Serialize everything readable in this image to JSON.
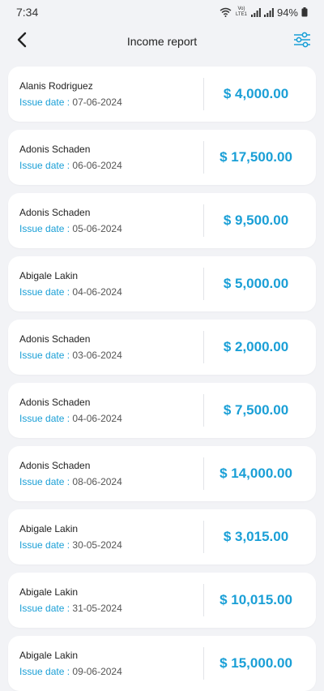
{
  "status_bar": {
    "time": "7:34",
    "network_label": "Vo) LTE1",
    "battery": "94%"
  },
  "header": {
    "title": "Income report"
  },
  "colors": {
    "accent": "#1a9fd6",
    "background": "#f2f3f6",
    "card": "#ffffff"
  },
  "icons": {
    "back": "back-arrow-icon",
    "filter": "sliders-icon"
  },
  "issue_label": "Issue date :",
  "invoices": [
    {
      "name": "Alanis Rodriguez",
      "date": "07-06-2024",
      "amount": "$ 4,000.00"
    },
    {
      "name": "Adonis Schaden",
      "date": "06-06-2024",
      "amount": "$ 17,500.00"
    },
    {
      "name": "Adonis Schaden",
      "date": "05-06-2024",
      "amount": "$ 9,500.00"
    },
    {
      "name": "Abigale Lakin",
      "date": "04-06-2024",
      "amount": "$ 5,000.00"
    },
    {
      "name": "Adonis Schaden",
      "date": "03-06-2024",
      "amount": "$ 2,000.00"
    },
    {
      "name": "Adonis Schaden",
      "date": "04-06-2024",
      "amount": "$ 7,500.00"
    },
    {
      "name": "Adonis Schaden",
      "date": "08-06-2024",
      "amount": "$ 14,000.00"
    },
    {
      "name": "Abigale Lakin",
      "date": "30-05-2024",
      "amount": "$ 3,015.00"
    },
    {
      "name": "Abigale Lakin",
      "date": "31-05-2024",
      "amount": "$ 10,015.00"
    },
    {
      "name": "Abigale Lakin",
      "date": "09-06-2024",
      "amount": "$ 15,000.00"
    }
  ]
}
